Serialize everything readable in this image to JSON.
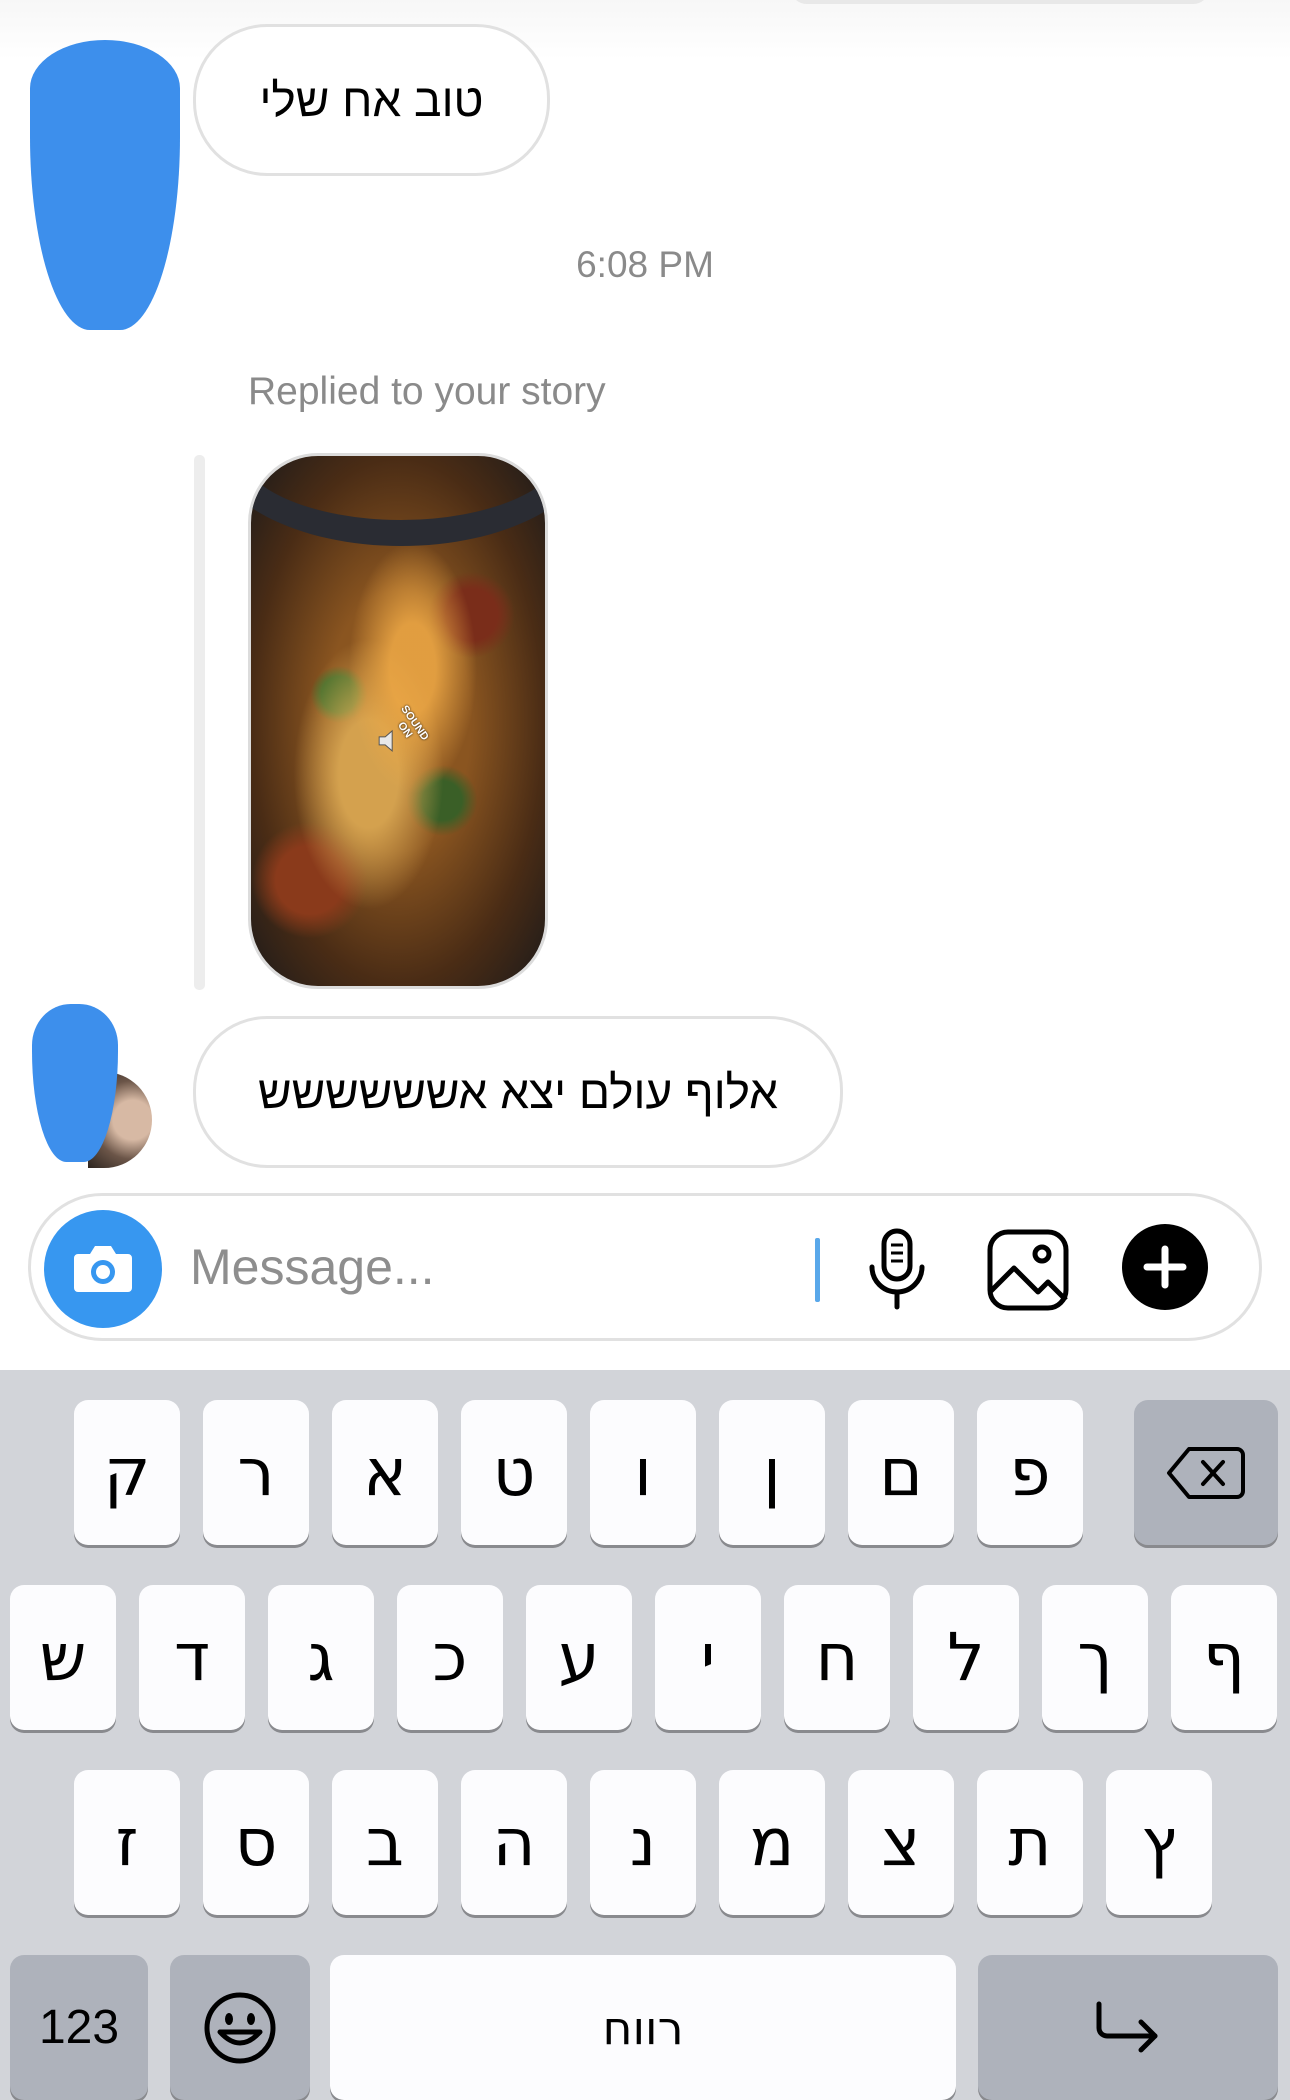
{
  "chat": {
    "messages": [
      {
        "text": "טוב אח שלי"
      },
      {
        "text": "אלוף עולם יצא אשששששש"
      }
    ],
    "timestamp": "6:08 PM",
    "replied_label": "Replied to your story",
    "story_sticker": [
      "SOUND",
      "ON"
    ]
  },
  "composer": {
    "placeholder": "Message...",
    "camera_icon": "camera-icon",
    "mic_icon": "microphone-icon",
    "gallery_icon": "image-icon",
    "plus_icon": "plus-icon",
    "accent_color": "#3797f0"
  },
  "keyboard": {
    "row1": [
      "ק",
      "ר",
      "א",
      "ט",
      "ו",
      "ן",
      "ם",
      "פ"
    ],
    "row2": [
      "ש",
      "ד",
      "ג",
      "כ",
      "ע",
      "י",
      "ח",
      "ל",
      "ך",
      "ף"
    ],
    "row3": [
      "ז",
      "ס",
      "ב",
      "ה",
      "נ",
      "מ",
      "צ",
      "ת",
      "ץ"
    ],
    "numbers_label": "123",
    "space_label": "רווח",
    "delete_icon": "backspace-icon",
    "emoji_icon": "emoji-icon",
    "return_icon": "return-arrow-icon"
  }
}
